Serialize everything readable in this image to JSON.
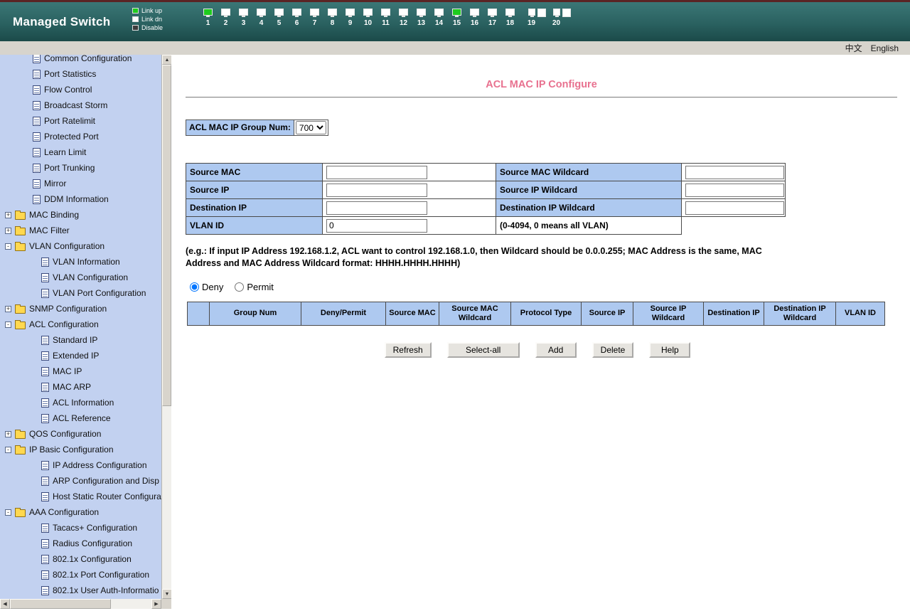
{
  "colors": {
    "title_pink": "#e8718f",
    "table_header_blue": "#aec9f0",
    "sidebar_blue": "#c2d1f0",
    "banner_teal_light": "#3b7776",
    "banner_teal_dark": "#1b4a49",
    "link_up_green": "#1ecb1e"
  },
  "header": {
    "title": "Managed Switch",
    "legend": [
      {
        "label": "Link up",
        "state": "up"
      },
      {
        "label": "Link dn",
        "state": "down"
      },
      {
        "label": "Disable",
        "state": "disable"
      }
    ],
    "ports": [
      {
        "num": "1",
        "state": "up",
        "kind": "single"
      },
      {
        "num": "2",
        "state": "down",
        "kind": "single"
      },
      {
        "num": "3",
        "state": "down",
        "kind": "single"
      },
      {
        "num": "4",
        "state": "down",
        "kind": "single"
      },
      {
        "num": "5",
        "state": "down",
        "kind": "single"
      },
      {
        "num": "6",
        "state": "down",
        "kind": "single"
      },
      {
        "num": "7",
        "state": "down",
        "kind": "single"
      },
      {
        "num": "8",
        "state": "down",
        "kind": "single"
      },
      {
        "num": "9",
        "state": "down",
        "kind": "single"
      },
      {
        "num": "10",
        "state": "down",
        "kind": "single"
      },
      {
        "num": "11",
        "state": "down",
        "kind": "single"
      },
      {
        "num": "12",
        "state": "down",
        "kind": "single"
      },
      {
        "num": "13",
        "state": "down",
        "kind": "single"
      },
      {
        "num": "14",
        "state": "down",
        "kind": "single"
      },
      {
        "num": "15",
        "state": "up",
        "kind": "single"
      },
      {
        "num": "16",
        "state": "down",
        "kind": "single"
      },
      {
        "num": "17",
        "state": "down",
        "kind": "single"
      },
      {
        "num": "18",
        "state": "down",
        "kind": "single"
      },
      {
        "num": "19",
        "state": "down",
        "kind": "double"
      },
      {
        "num": "20",
        "state": "down",
        "kind": "double"
      }
    ]
  },
  "langbar": {
    "chinese": "中文",
    "english": "English"
  },
  "sidebar": {
    "items": [
      {
        "label": "Common Configuration",
        "type": "doc",
        "indent": "lvl1"
      },
      {
        "label": "Port Statistics",
        "type": "doc",
        "indent": "lvl1"
      },
      {
        "label": "Flow Control",
        "type": "doc",
        "indent": "lvl1"
      },
      {
        "label": "Broadcast Storm",
        "type": "doc",
        "indent": "lvl1"
      },
      {
        "label": "Port Ratelimit",
        "type": "doc",
        "indent": "lvl1"
      },
      {
        "label": "Protected Port",
        "type": "doc",
        "indent": "lvl1"
      },
      {
        "label": "Learn Limit",
        "type": "doc",
        "indent": "lvl1"
      },
      {
        "label": "Port Trunking",
        "type": "doc",
        "indent": "lvl1"
      },
      {
        "label": "Mirror",
        "type": "doc",
        "indent": "lvl1"
      },
      {
        "label": "DDM Information",
        "type": "doc",
        "indent": "lvl1"
      },
      {
        "label": "MAC Binding",
        "type": "folder-collapsed",
        "indent": "lvl0"
      },
      {
        "label": "MAC Filter",
        "type": "folder-collapsed",
        "indent": "lvl0"
      },
      {
        "label": "VLAN Configuration",
        "type": "folder-expanded",
        "indent": "lvl0"
      },
      {
        "label": "VLAN Information",
        "type": "doc",
        "indent": "lvl2"
      },
      {
        "label": "VLAN Configuration",
        "type": "doc",
        "indent": "lvl2"
      },
      {
        "label": "VLAN Port Configuration",
        "type": "doc",
        "indent": "lvl2"
      },
      {
        "label": "SNMP Configuration",
        "type": "folder-collapsed",
        "indent": "lvl0"
      },
      {
        "label": "ACL Configuration",
        "type": "folder-expanded",
        "indent": "lvl0"
      },
      {
        "label": "Standard IP",
        "type": "doc",
        "indent": "lvl2"
      },
      {
        "label": "Extended IP",
        "type": "doc",
        "indent": "lvl2"
      },
      {
        "label": "MAC IP",
        "type": "doc",
        "indent": "lvl2"
      },
      {
        "label": "MAC ARP",
        "type": "doc",
        "indent": "lvl2"
      },
      {
        "label": "ACL Information",
        "type": "doc",
        "indent": "lvl2"
      },
      {
        "label": "ACL Reference",
        "type": "doc",
        "indent": "lvl2"
      },
      {
        "label": "QOS Configuration",
        "type": "folder-collapsed",
        "indent": "lvl0"
      },
      {
        "label": "IP Basic Configuration",
        "type": "folder-expanded",
        "indent": "lvl0"
      },
      {
        "label": "IP Address Configuration",
        "type": "doc",
        "indent": "lvl2"
      },
      {
        "label": "ARP Configuration and Disp",
        "type": "doc",
        "indent": "lvl2"
      },
      {
        "label": "Host Static Router Configura",
        "type": "doc",
        "indent": "lvl2"
      },
      {
        "label": "AAA Configuration",
        "type": "folder-expanded",
        "indent": "lvl0"
      },
      {
        "label": "Tacacs+ Configuration",
        "type": "doc",
        "indent": "lvl2"
      },
      {
        "label": "Radius Configuration",
        "type": "doc",
        "indent": "lvl2"
      },
      {
        "label": "802.1x Configuration",
        "type": "doc",
        "indent": "lvl2"
      },
      {
        "label": "802.1x Port Configuration",
        "type": "doc",
        "indent": "lvl2"
      },
      {
        "label": "802.1x User Auth-Informatio",
        "type": "doc",
        "indent": "lvl2"
      }
    ]
  },
  "main": {
    "title": "ACL MAC IP Configure",
    "group_num": {
      "label": "ACL MAC IP Group Num:",
      "value": "700"
    },
    "form": {
      "source_mac": {
        "label": "Source MAC",
        "value": ""
      },
      "source_mac_wildcard": {
        "label": "Source MAC Wildcard",
        "value": ""
      },
      "source_ip": {
        "label": "Source IP",
        "value": ""
      },
      "source_ip_wildcard": {
        "label": "Source IP Wildcard",
        "value": ""
      },
      "destination_ip": {
        "label": "Destination IP",
        "value": ""
      },
      "destination_ip_wildcard": {
        "label": "Destination IP Wildcard",
        "value": ""
      },
      "vlan_id": {
        "label": "VLAN ID",
        "value": "0",
        "note": "(0-4094, 0 means all VLAN)"
      }
    },
    "example_note": "(e.g.: If input IP Address 192.168.1.2, ACL want to control 192.168.1.0, then Wildcard should be 0.0.0.255; MAC Address is the same, MAC Address and MAC Address Wildcard format: HHHH.HHHH.HHHH)",
    "radio_deny": {
      "label": "Deny",
      "checked": "checked"
    },
    "radio_permit": {
      "label": "Permit"
    },
    "table_headers": [
      "",
      "Group Num",
      "Deny/Permit",
      "Source MAC",
      "Source MAC Wildcard",
      "Protocol Type",
      "Source IP",
      "Source IP Wildcard",
      "Destination IP",
      "Destination IP Wildcard",
      "VLAN ID"
    ],
    "buttons": {
      "refresh": "Refresh",
      "select_all": "Select-all",
      "add": "Add",
      "delete": "Delete",
      "help": "Help"
    }
  }
}
